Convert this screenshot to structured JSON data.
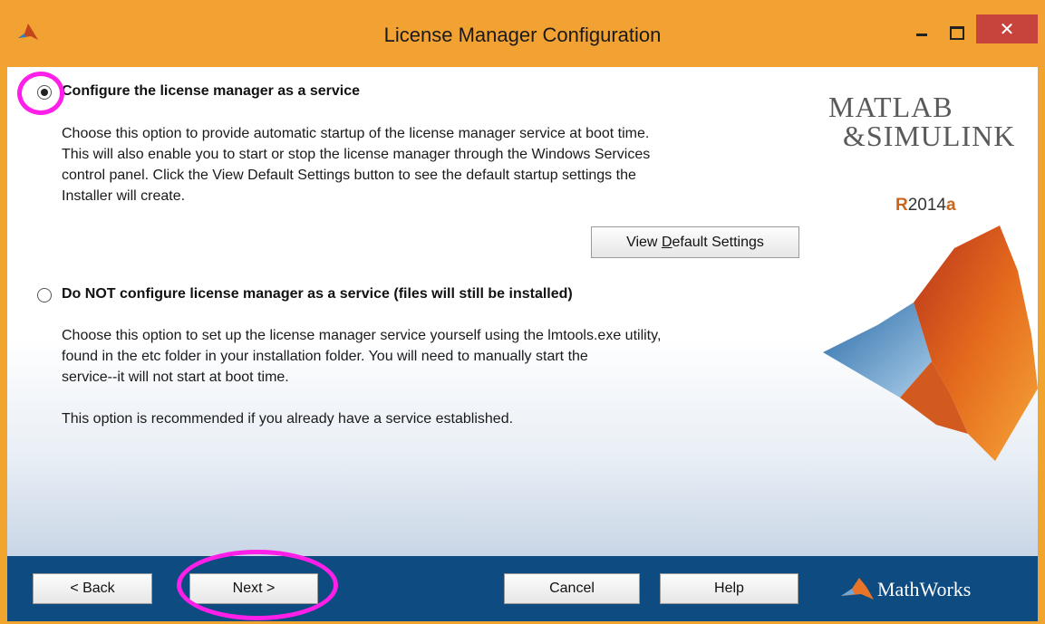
{
  "window": {
    "title": "License Manager Configuration",
    "close_glyph": "✕"
  },
  "options": [
    {
      "label": "Configure the license manager as a service",
      "selected": true,
      "description": [
        "Choose this option to provide automatic startup of the license manager service at boot time.",
        "This will also enable you to start or stop the license manager through the Windows Services",
        "control panel. Click the View Default Settings button to see the default startup settings the",
        "Installer will create."
      ]
    },
    {
      "label": "Do NOT configure license manager as a service (files will still be installed)",
      "selected": false,
      "description": [
        "Choose this option to set up the license manager service yourself using the lmtools.exe utility,",
        "found in the etc folder in your installation folder. You will need to manually start the",
        "service--it will not start at boot time.",
        "",
        "This option is recommended if you already have a service established."
      ]
    }
  ],
  "view_default_settings": {
    "label_pre": "View ",
    "label_key": "D",
    "label_post": "efault Settings"
  },
  "branding": {
    "matlab": "MATLAB",
    "simulink": "&SIMULINK",
    "release_r": "R",
    "release_year": "2014",
    "release_a": "a",
    "mathworks": "MathWorks"
  },
  "footer": {
    "back_label": "< Back",
    "next_label": "Next >",
    "cancel_label": "Cancel",
    "help_label": "Help"
  },
  "colors": {
    "titlebar": "#f2a233",
    "footer": "#0d4b80",
    "highlight": "#ff1fe8",
    "close": "#c7443c"
  }
}
